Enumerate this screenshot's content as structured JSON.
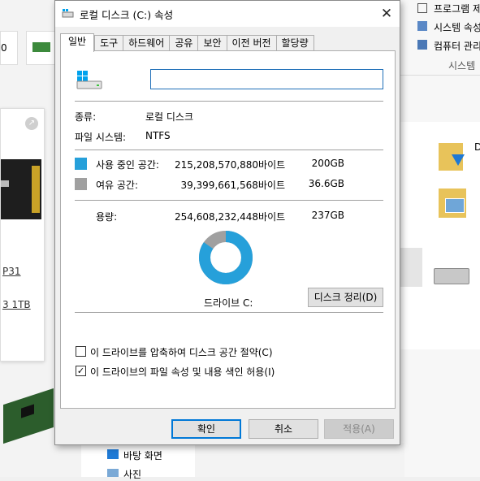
{
  "window": {
    "title": "로컬 디스크 (C:) 속성",
    "close_label": "✕"
  },
  "tabs": [
    "일반",
    "도구",
    "하드웨어",
    "공유",
    "보안",
    "이전 버전",
    "할당량"
  ],
  "general": {
    "drive_name_value": "",
    "type_label": "종류:",
    "type_value": "로컬 디스크",
    "fs_label": "파일 시스템:",
    "fs_value": "NTFS",
    "used_label": "사용 중인 공간:",
    "used_bytes": "215,208,570,880바이트",
    "used_size": "200GB",
    "free_label": "여유 공간:",
    "free_bytes": "39,399,661,568바이트",
    "free_size": "36.6GB",
    "capacity_label": "용량:",
    "capacity_bytes": "254,608,232,448바이트",
    "capacity_size": "237GB",
    "used_fraction": 0.8453,
    "drive_label": "드라이브 C:",
    "cleanup_button": "디스크 정리(D)",
    "compress_label": "이 드라이브를 압축하여 디스크 공간 절약(C)",
    "compress_checked": false,
    "index_label": "이 드라이브의 파일 속성 및 내용 색인 허용(I)",
    "index_checked": true
  },
  "buttons": {
    "ok": "확인",
    "cancel": "취소",
    "apply": "적용(A)"
  },
  "colors": {
    "used": "#26a0da",
    "free": "#a0a0a0"
  },
  "background": {
    "left_texts": [
      "0",
      "P31",
      "3 1TB"
    ],
    "right_menu": [
      "프로그램 제",
      "시스템 속성",
      "컴퓨터 관리"
    ],
    "right_group": "시스템",
    "bottom_items": [
      "바탕 화면",
      "사진"
    ]
  }
}
